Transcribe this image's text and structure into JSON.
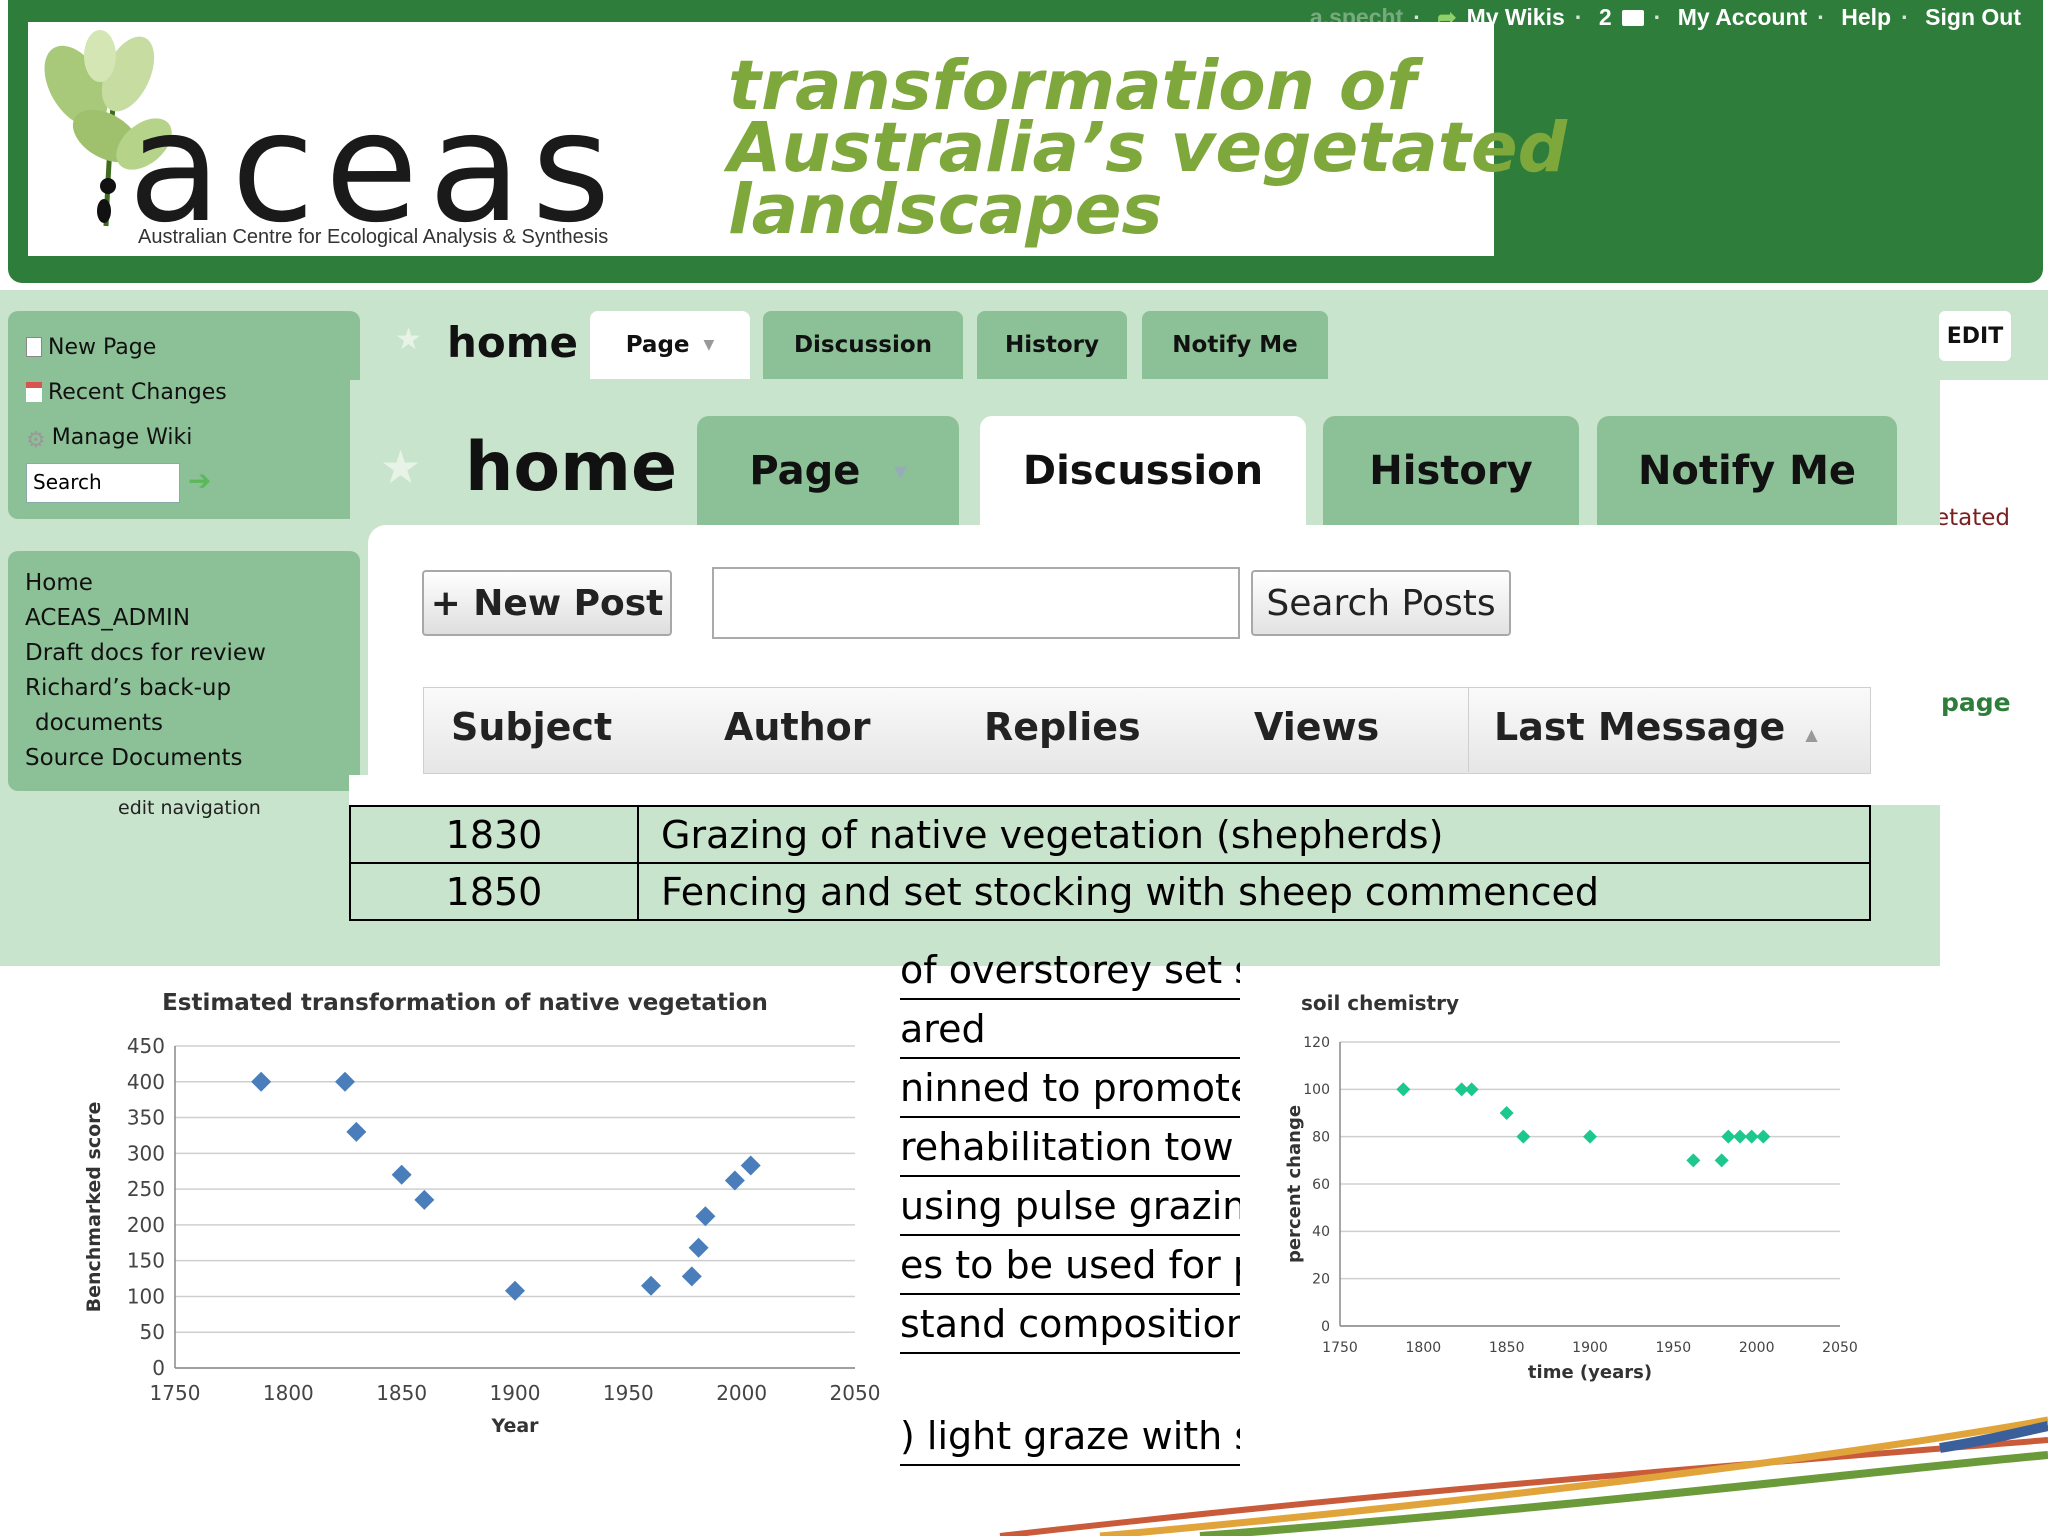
{
  "header": {
    "top_links": [
      "a.specht",
      "My Wikis",
      "2",
      "My Account",
      "Help",
      "Sign Out"
    ],
    "logo_text": "aceas",
    "logo_subtitle": "Australian Centre for Ecological Analysis & Synthesis",
    "tagline": [
      "transformation of",
      "Australia’s vegetated",
      "landscapes"
    ]
  },
  "sidebar": {
    "actions": [
      "New Page",
      "Recent Changes",
      "Manage Wiki"
    ],
    "search_value": "Search",
    "nav": [
      "Home",
      "ACEAS_ADMIN",
      "Draft docs for review",
      "Richard’s back-up",
      "documents",
      "Source Documents"
    ],
    "edit_nav": "edit navigation"
  },
  "page_tabs_small": {
    "title": "home",
    "tabs": [
      "Page",
      "Discussion",
      "History",
      "Notify Me"
    ],
    "edit": "EDIT"
  },
  "page_tabs_big": {
    "title": "home",
    "tabs": [
      "Page",
      "Discussion",
      "History",
      "Notify Me"
    ],
    "active": "Discussion"
  },
  "discussion": {
    "new_post": "+ New Post",
    "search_value": "",
    "search_posts": "Search Posts",
    "columns": [
      "Subject",
      "Author",
      "Replies",
      "Views",
      "Last Message"
    ]
  },
  "right_edge": {
    "fragment_1": "etated",
    "fragment_2": "page"
  },
  "timeline": [
    {
      "year": "1830",
      "event": "Grazing of native vegetation (shepherds)"
    },
    {
      "year": "1850",
      "event": "Fencing and set stocking with sheep commenced"
    }
  ],
  "timeline_fragments": [
    "of overstorey set st",
    "ared",
    "ninned to promote",
    "rehabilitation tow",
    "using pulse grazing",
    "es to be used for p",
    "stand composition",
    ") light graze with sh"
  ],
  "colors": {
    "header_green": "#2e7d3a",
    "sidebar_green": "#8cc096",
    "page_bg_green": "#c9e4cc",
    "tagline_green": "#7fa83c",
    "chart1_marker": "#4a7ebb",
    "chart2_marker": "#1dc88e"
  },
  "chart_data": [
    {
      "type": "scatter",
      "title": "Estimated transformation of native vegetation",
      "xlabel": "Year",
      "ylabel": "Benchmarked score",
      "xlim": [
        1750,
        2050
      ],
      "ylim": [
        0,
        450
      ],
      "xticks": [
        1750,
        1800,
        1850,
        1900,
        1950,
        2000,
        2050
      ],
      "yticks": [
        0,
        50,
        100,
        150,
        200,
        250,
        300,
        350,
        400,
        450
      ],
      "grid": true,
      "x": [
        1788,
        1825,
        1830,
        1850,
        1860,
        1900,
        1960,
        1978,
        1981,
        1984,
        1997,
        2004
      ],
      "y": [
        400,
        400,
        330,
        270,
        235,
        108,
        115,
        128,
        168,
        212,
        262,
        283
      ]
    },
    {
      "type": "scatter",
      "title": "soil chemistry",
      "xlabel": "time (years)",
      "ylabel": "percent change",
      "xlim": [
        1750,
        2050
      ],
      "ylim": [
        0,
        120
      ],
      "xticks": [
        1750,
        1800,
        1850,
        1900,
        1950,
        2000,
        2050
      ],
      "yticks": [
        0,
        20,
        40,
        60,
        80,
        100,
        120
      ],
      "grid": true,
      "x": [
        1788,
        1823,
        1829,
        1850,
        1860,
        1900,
        1962,
        1979,
        1983,
        1990,
        1997,
        2004
      ],
      "y": [
        100,
        100,
        100,
        90,
        80,
        80,
        70,
        70,
        80,
        80,
        80,
        80
      ]
    }
  ]
}
